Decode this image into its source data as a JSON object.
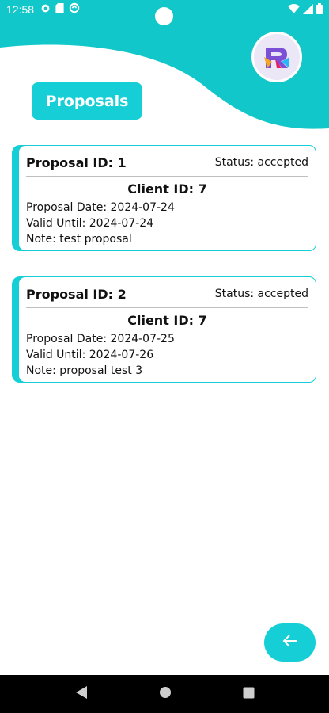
{
  "status_bar": {
    "time": "12:58",
    "left_icons": [
      "gear-icon",
      "sd-card-icon",
      "sync-icon"
    ],
    "right_icons": [
      "wifi-icon",
      "signal-icon",
      "battery-icon"
    ]
  },
  "header": {
    "title": "Proposals",
    "logo": "app-logo-R",
    "accent_color": "#16cfd6"
  },
  "proposals": [
    {
      "id_label": "Proposal ID: 1",
      "status": "Status: accepted",
      "client": "Client ID: 7",
      "proposal_date": "Proposal Date: 2024-07-24",
      "valid_until": "Valid Until: 2024-07-24",
      "note": "Note: test proposal"
    },
    {
      "id_label": "Proposal ID: 2",
      "status": "Status: accepted",
      "client": "Client ID: 7",
      "proposal_date": "Proposal Date: 2024-07-25",
      "valid_until": "Valid Until: 2024-07-26",
      "note": "Note: proposal test 3"
    }
  ],
  "fab": {
    "icon": "arrow-left-icon"
  },
  "nav_bar": {
    "icons": [
      "back-triangle-icon",
      "home-circle-icon",
      "recents-square-icon"
    ]
  }
}
